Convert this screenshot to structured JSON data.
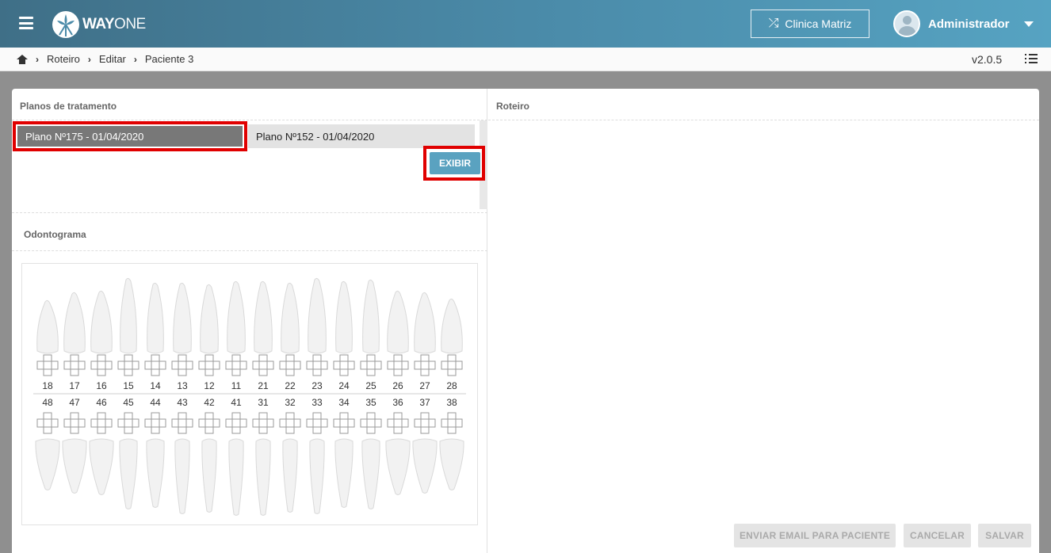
{
  "header": {
    "logo_bold": "WAY",
    "logo_light": "ONE",
    "clinic_label": "Clinica Matriz",
    "user_name": "Administrador"
  },
  "breadcrumb": {
    "items": [
      "Roteiro",
      "Editar",
      "Paciente 3"
    ],
    "version": "v2.0.5"
  },
  "plans": {
    "title": "Planos de tratamento",
    "items": [
      "Plano Nº175 - 01/04/2020",
      "Plano Nº152 - 01/04/2020"
    ],
    "selected": 0,
    "show_label": "EXIBIR"
  },
  "odontogram": {
    "title": "Odontograma",
    "upper_teeth": [
      "18",
      "17",
      "16",
      "15",
      "14",
      "13",
      "12",
      "11",
      "21",
      "22",
      "23",
      "24",
      "25",
      "26",
      "27",
      "28"
    ],
    "lower_teeth": [
      "48",
      "47",
      "46",
      "45",
      "44",
      "43",
      "42",
      "41",
      "31",
      "32",
      "33",
      "34",
      "35",
      "36",
      "37",
      "38"
    ]
  },
  "roteiro": {
    "title": "Roteiro"
  },
  "actions": {
    "email_label": "ENVIAR EMAIL PARA PACIENTE",
    "cancel_label": "CANCELAR",
    "save_label": "SALVAR"
  },
  "colors": {
    "header_start": "#3f6f87",
    "header_end": "#56a3c2",
    "accent": "#5aa2c0",
    "highlight": "#e00000"
  }
}
